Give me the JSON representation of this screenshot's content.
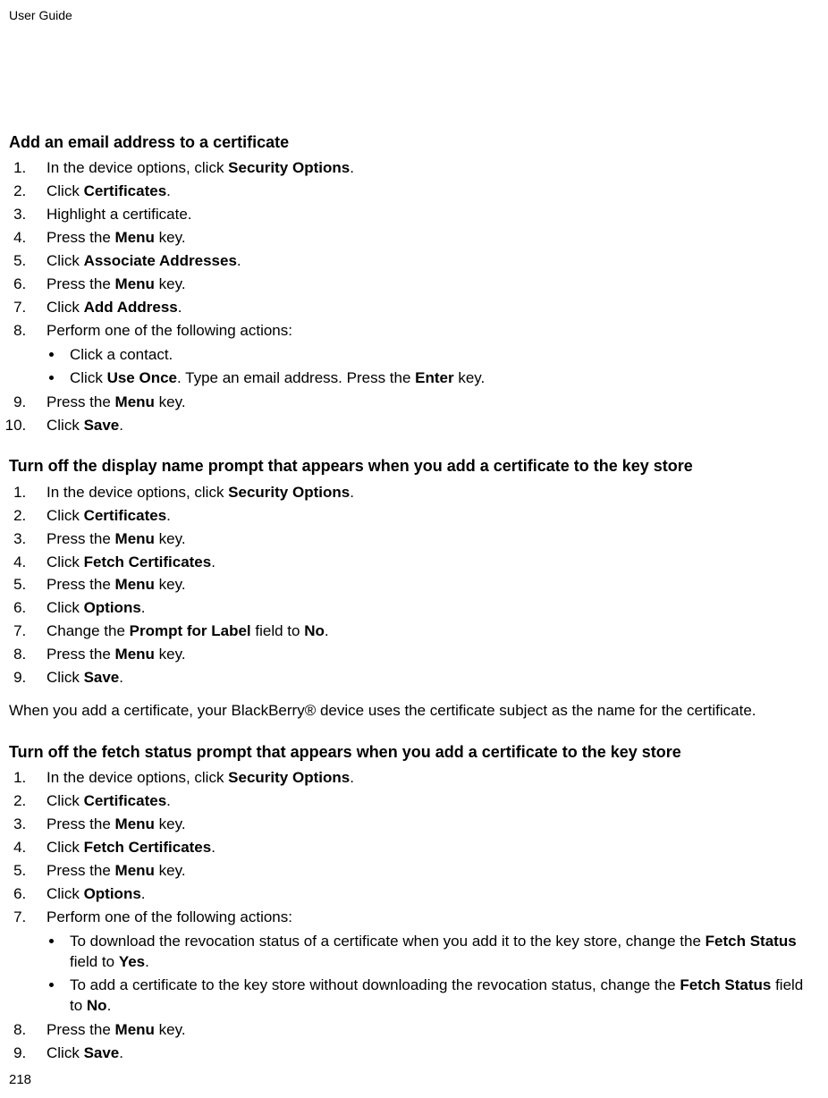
{
  "doc": {
    "header": "User Guide",
    "page_number": "218"
  },
  "section1": {
    "title": "Add an email address to a certificate",
    "steps": {
      "s1a": "In the device options, click ",
      "s1b": "Security Options",
      "s1c": ".",
      "s2a": "Click ",
      "s2b": "Certificates",
      "s2c": ".",
      "s3": "Highlight a certificate.",
      "s4a": "Press the ",
      "s4b": "Menu",
      "s4c": " key.",
      "s5a": "Click ",
      "s5b": "Associate Addresses",
      "s5c": ".",
      "s6a": "Press the ",
      "s6b": "Menu",
      "s6c": " key.",
      "s7a": "Click ",
      "s7b": "Add Address",
      "s7c": ".",
      "s8": "Perform one of the following actions:",
      "s8_sub1": "Click a contact.",
      "s8_sub2a": "Click ",
      "s8_sub2b": "Use Once",
      "s8_sub2c": ". Type an email address. Press the ",
      "s8_sub2d": "Enter",
      "s8_sub2e": " key.",
      "s9a": "Press the ",
      "s9b": "Menu",
      "s9c": " key.",
      "s10a": "Click ",
      "s10b": "Save",
      "s10c": "."
    }
  },
  "section2": {
    "title": "Turn off the display name prompt that appears when you add a certificate to the key store",
    "steps": {
      "s1a": "In the device options, click ",
      "s1b": "Security Options",
      "s1c": ".",
      "s2a": "Click ",
      "s2b": "Certificates",
      "s2c": ".",
      "s3a": "Press the ",
      "s3b": "Menu",
      "s3c": " key.",
      "s4a": "Click ",
      "s4b": "Fetch Certificates",
      "s4c": ".",
      "s5a": "Press the ",
      "s5b": "Menu",
      "s5c": " key.",
      "s6a": "Click ",
      "s6b": "Options",
      "s6c": ".",
      "s7a": "Change the ",
      "s7b": "Prompt for Label",
      "s7c": " field to ",
      "s7d": "No",
      "s7e": ".",
      "s8a": "Press the ",
      "s8b": "Menu",
      "s8c": " key.",
      "s9a": "Click ",
      "s9b": "Save",
      "s9c": "."
    },
    "note": "When you add a certificate, your BlackBerry® device uses the certificate subject as the name for the certificate."
  },
  "section3": {
    "title": "Turn off the fetch status prompt that appears when you add a certificate to the key store",
    "steps": {
      "s1a": "In the device options, click ",
      "s1b": "Security Options",
      "s1c": ".",
      "s2a": "Click ",
      "s2b": "Certificates",
      "s2c": ".",
      "s3a": "Press the ",
      "s3b": "Menu",
      "s3c": " key.",
      "s4a": "Click ",
      "s4b": "Fetch Certificates",
      "s4c": ".",
      "s5a": "Press the ",
      "s5b": "Menu",
      "s5c": " key.",
      "s6a": "Click ",
      "s6b": "Options",
      "s6c": ".",
      "s7": "Perform one of the following actions:",
      "s7_sub1a": "To download the revocation status of a certificate when you add it to the key store, change the ",
      "s7_sub1b": "Fetch Status",
      "s7_sub1c": " field to ",
      "s7_sub1d": "Yes",
      "s7_sub1e": ".",
      "s7_sub2a": "To add a certificate to the key store without downloading the revocation status, change the ",
      "s7_sub2b": "Fetch Status",
      "s7_sub2c": " field to ",
      "s7_sub2d": "No",
      "s7_sub2e": ".",
      "s8a": "Press the ",
      "s8b": "Menu",
      "s8c": " key.",
      "s9a": "Click ",
      "s9b": "Save",
      "s9c": "."
    }
  }
}
